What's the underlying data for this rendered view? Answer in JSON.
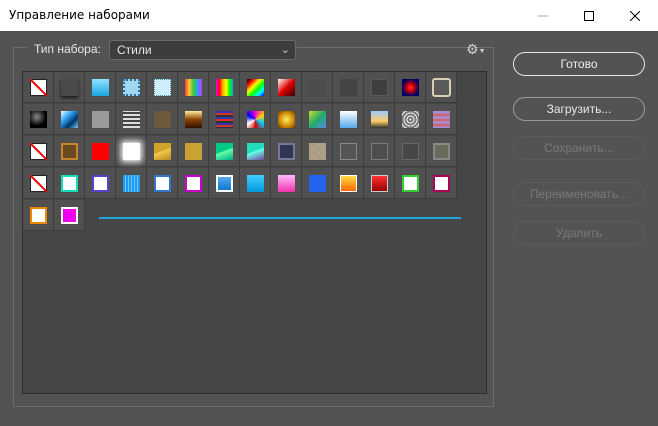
{
  "window": {
    "title": "Управление наборами",
    "minimize_icon": "minimize-icon",
    "maximize_icon": "maximize-icon",
    "close_icon": "close-icon"
  },
  "preset_type": {
    "label": "Тип набора:",
    "selected": "Стили"
  },
  "buttons": {
    "done": "Готово",
    "load": "Загрузить...",
    "save": "Сохранить...",
    "rename": "Переименовать...",
    "delete": "Удалить"
  },
  "colors": {
    "accent_line": "#1ea8dc",
    "background": "#535353"
  },
  "styles": [
    [
      "none",
      "shadow-dark",
      "cyan-gradient",
      "blue-dotted",
      "light-blue-dotted",
      "rainbow-v",
      "rainbow-h",
      "spectrum",
      "red-black",
      "gray",
      "gray-dark",
      "gray-darker",
      "blue-red-glow",
      "beige-frame"
    ],
    [
      "black-ball",
      "blue-chrome",
      "gray-flat",
      "metal-dots",
      "brown-wood",
      "gold-dark",
      "purple-stripes",
      "colorful-noise",
      "gold-shiny",
      "green-blue",
      "sky-blue",
      "sunset",
      "lace",
      "lilac-stripes"
    ],
    [
      "none",
      "brown-frame",
      "red",
      "white-glow",
      "gold-envelope",
      "gold",
      "teal-green",
      "teal-purple",
      "blue-gold",
      "tan-texture",
      "outline-dark",
      "outline-gray",
      "outline-darker",
      "outline-olive"
    ],
    [
      "none",
      "teal-frame",
      "purple-frame",
      "blue-bars",
      "white-blue",
      "magenta-frame",
      "blue-bevel",
      "cyan-bevel",
      "pink-gradient",
      "blue-solid",
      "orange-gradient",
      "red-gradient",
      "green-frame",
      "magenta-frame-dark"
    ],
    [
      "orange-frame",
      "magenta-solid"
    ]
  ]
}
